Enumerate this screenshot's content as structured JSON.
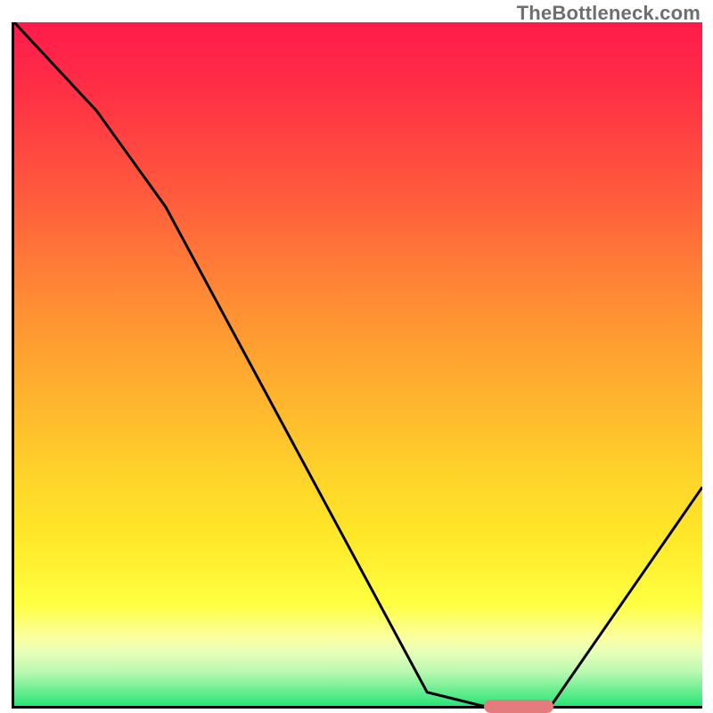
{
  "watermark": "TheBottleneck.com",
  "colors": {
    "gradient_top": "#ff1b4b",
    "gradient_bottom": "#29e578",
    "marker": "#e67b7d",
    "line": "#000000",
    "axis": "#000000",
    "watermark_text": "#6e6e6e"
  },
  "chart_data": {
    "type": "line",
    "title": "",
    "xlabel": "",
    "ylabel": "",
    "xlim": [
      0,
      100
    ],
    "ylim": [
      0,
      100
    ],
    "x": [
      0,
      12,
      22,
      60,
      68,
      78,
      100
    ],
    "values": [
      100,
      87,
      73,
      2,
      0,
      0,
      32
    ],
    "marker": {
      "x_start": 68,
      "x_end": 78,
      "y": 0
    },
    "annotations": [],
    "grid": false,
    "legend": false
  }
}
